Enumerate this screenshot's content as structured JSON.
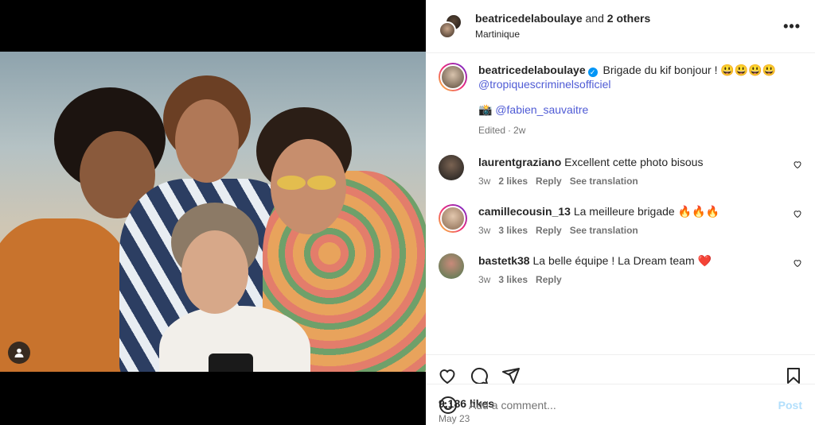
{
  "header": {
    "username": "beatricedelaboulaye",
    "and_text": " and ",
    "others": "2 others",
    "location": "Martinique"
  },
  "caption": {
    "username": "beatricedelaboulaye",
    "text": "Brigade du kif bonjour ! 😃😃😃😃",
    "mention": "@tropiquescriminelsofficiel",
    "camera_emoji": "📸",
    "credit": "@fabien_sauvaitre",
    "edited": "Edited",
    "time": "2w"
  },
  "comments": [
    {
      "username": "laurentgraziano",
      "text": "Excellent cette photo bisous",
      "time": "3w",
      "likes": "2 likes",
      "reply": "Reply",
      "translate": "See translation",
      "avatar_color": "#2b2b2b"
    },
    {
      "username": "camillecousin_13",
      "text": "La meilleure brigade 🔥🔥🔥",
      "time": "3w",
      "likes": "3 likes",
      "reply": "Reply",
      "translate": "See translation",
      "avatar_color": "#c9a98a"
    },
    {
      "username": "bastetk38",
      "text": "La belle équipe ! La Dream team ❤️",
      "time": "3w",
      "likes": "3 likes",
      "reply": "Reply",
      "translate": "",
      "avatar_color": "#7aa37a"
    }
  ],
  "stats": {
    "likes": "9,186 likes",
    "date": "May 23"
  },
  "add_comment": {
    "placeholder": "Add a comment...",
    "post": "Post"
  },
  "icons": [
    "more-icon",
    "verified-icon",
    "heart-icon",
    "comment-icon",
    "share-icon",
    "save-icon",
    "emoji-icon",
    "user-tag-icon"
  ],
  "colors": {
    "accent": "#0095f6",
    "link": "#4f5bd5",
    "post_disabled": "#b2dffc"
  }
}
